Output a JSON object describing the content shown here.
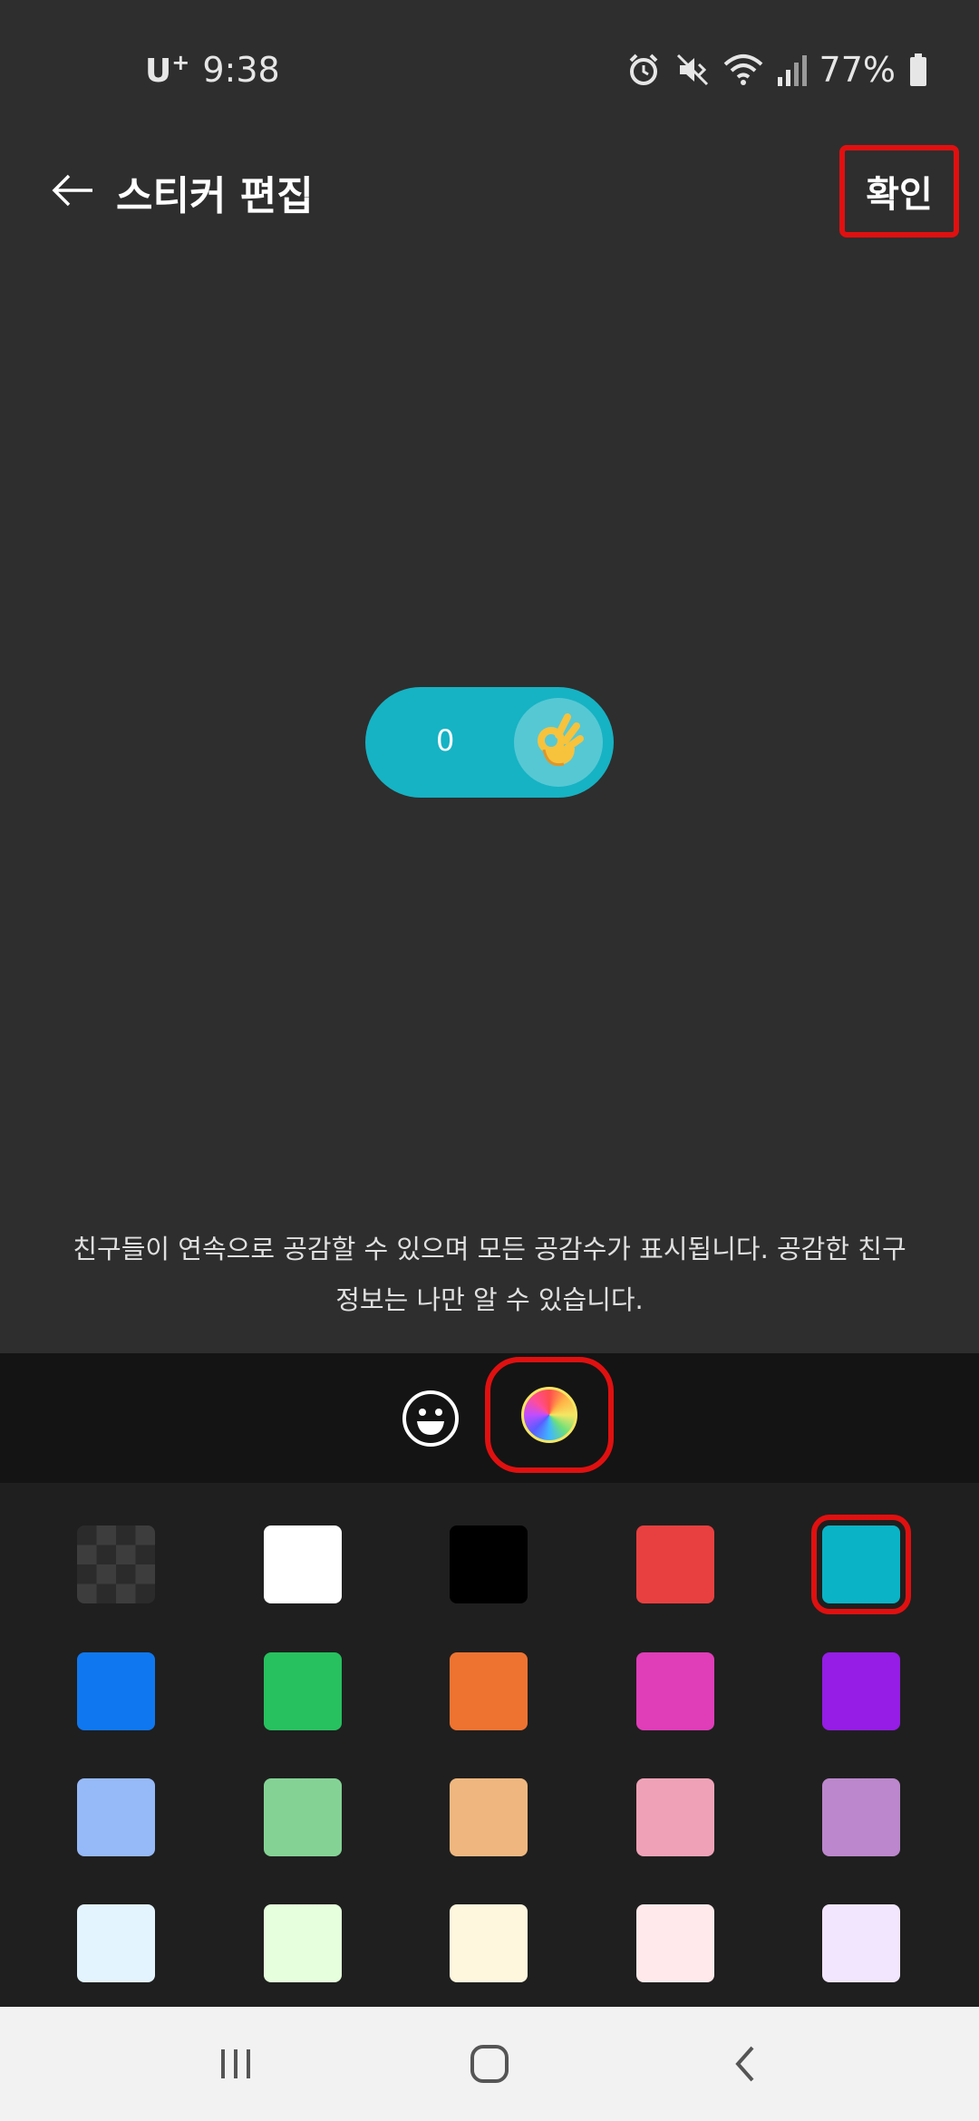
{
  "status_bar": {
    "carrier": "U",
    "carrier_plus": "+",
    "time": "9:38",
    "battery": "77%",
    "icons": [
      "alarm-icon",
      "mute-icon",
      "wifi-icon",
      "signal-icon",
      "battery-icon"
    ]
  },
  "header": {
    "title": "스티커 편집",
    "confirm_label": "확인",
    "back_icon": "arrow-left-icon"
  },
  "sticker": {
    "count": "0",
    "emoji": "👌",
    "color": "#16b3c4"
  },
  "description": {
    "line1": "친구들이 연속으로 공감할 수 있으며 모든 공감수가 표시됩니다. 공감한 친구",
    "line2": "정보는 나만 알 수 있습니다."
  },
  "toolbar": {
    "tabs": [
      "emoji-icon",
      "color-wheel-icon"
    ],
    "selected_tab": "color-wheel-icon"
  },
  "palette": {
    "selected": "#0bb3c6",
    "colors": [
      [
        "transparent",
        "#ffffff",
        "#000000",
        "#e84040",
        "#0bb3c6"
      ],
      [
        "#0f78f0",
        "#27c15f",
        "#ee7331",
        "#e03db9",
        "#951de6"
      ],
      [
        "#96b9f8",
        "#84d395",
        "#efb77f",
        "#efa2b7",
        "#bc87cc"
      ],
      [
        "#e3f4ff",
        "#e6ffdc",
        "#fff6de",
        "#ffe9ea",
        "#f2e6ff"
      ]
    ]
  },
  "nav_bar": {
    "buttons": [
      "recent-apps-icon",
      "home-icon",
      "back-icon"
    ]
  }
}
